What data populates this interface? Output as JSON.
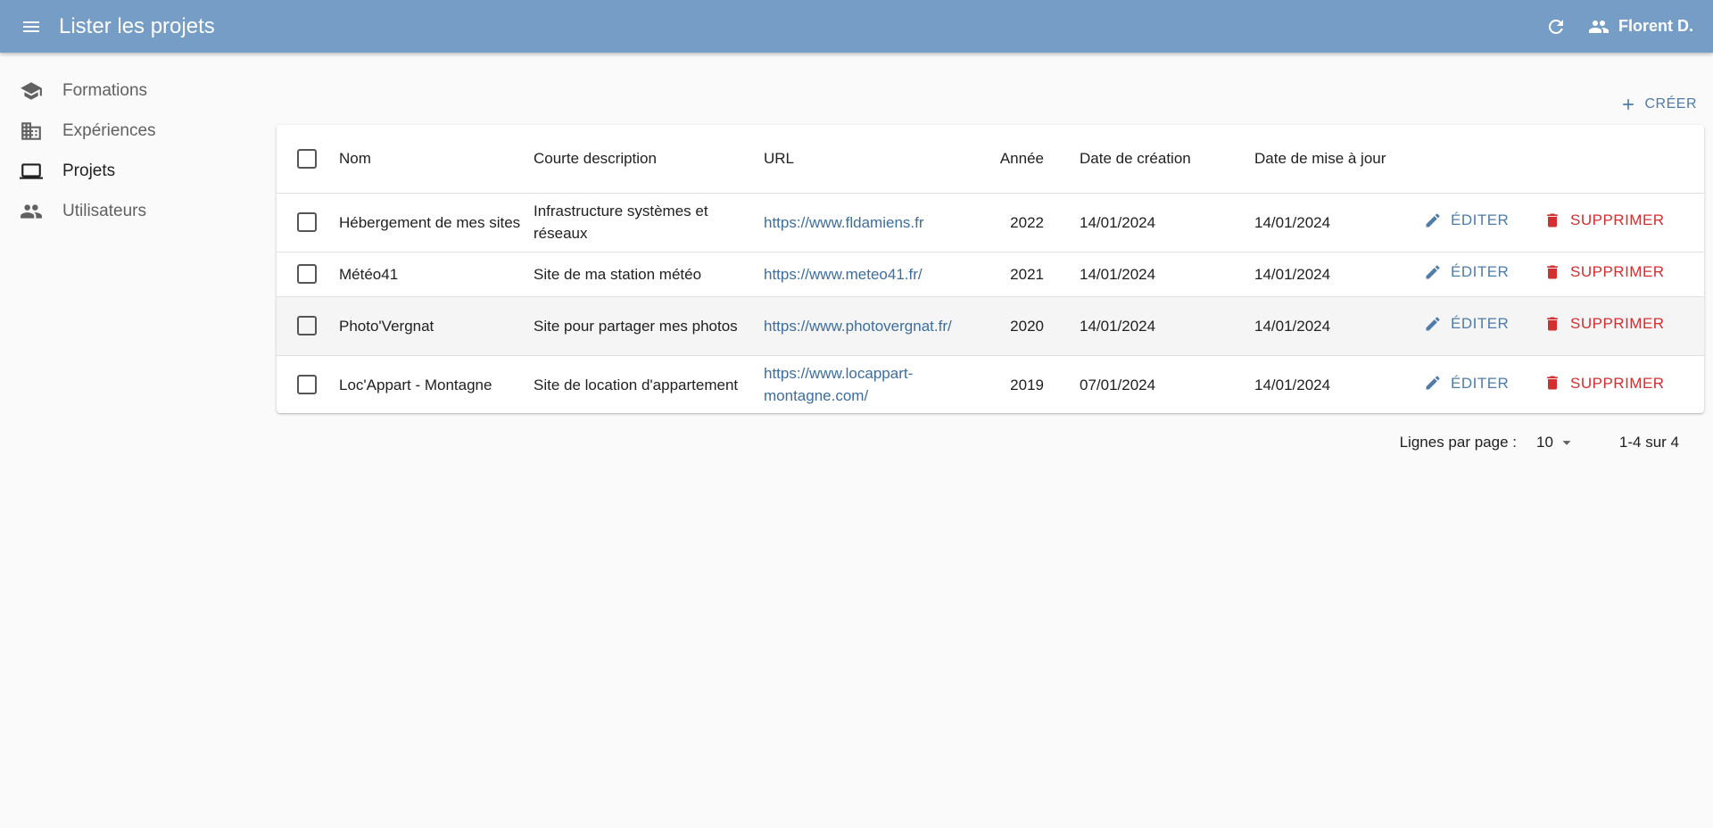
{
  "appbar": {
    "title": "Lister les projets",
    "user_name": "Florent D.",
    "color": "#759dc5"
  },
  "sidebar": {
    "items": [
      {
        "label": "Formations",
        "icon": "school-icon"
      },
      {
        "label": "Expériences",
        "icon": "business-icon"
      },
      {
        "label": "Projets",
        "icon": "laptop-icon",
        "active": true
      },
      {
        "label": "Utilisateurs",
        "icon": "people-icon"
      }
    ]
  },
  "toolbar": {
    "create_label": "CRÉER"
  },
  "table": {
    "headers": {
      "name": "Nom",
      "description": "Courte description",
      "url": "URL",
      "year": "Année",
      "created": "Date de création",
      "updated": "Date de mise à jour"
    },
    "edit_label": "ÉDITER",
    "delete_label": "SUPPRIMER",
    "rows": [
      {
        "name": "Hébergement de mes sites",
        "description": "Infrastructure systèmes et réseaux",
        "url": "https://www.fldamiens.fr",
        "year": "2022",
        "created": "14/01/2024",
        "updated": "14/01/2024"
      },
      {
        "name": "Météo41",
        "description": "Site de ma station météo",
        "url": "https://www.meteo41.fr/",
        "year": "2021",
        "created": "14/01/2024",
        "updated": "14/01/2024"
      },
      {
        "name": "Photo'Vergnat",
        "description": "Site pour partager mes photos",
        "url": "https://www.photovergnat.fr/",
        "year": "2020",
        "created": "14/01/2024",
        "updated": "14/01/2024"
      },
      {
        "name": "Loc'Appart - Montagne",
        "description": "Site de location d'appartement",
        "url": "https://www.locappart-montagne.com/",
        "year": "2019",
        "created": "07/01/2024",
        "updated": "14/01/2024"
      }
    ]
  },
  "pagination": {
    "rows_per_page_label": "Lignes par page :",
    "rows_per_page": "10",
    "range": "1-4 sur 4"
  },
  "colors": {
    "accent": "#4f7ca8",
    "danger": "#d32f2f"
  }
}
